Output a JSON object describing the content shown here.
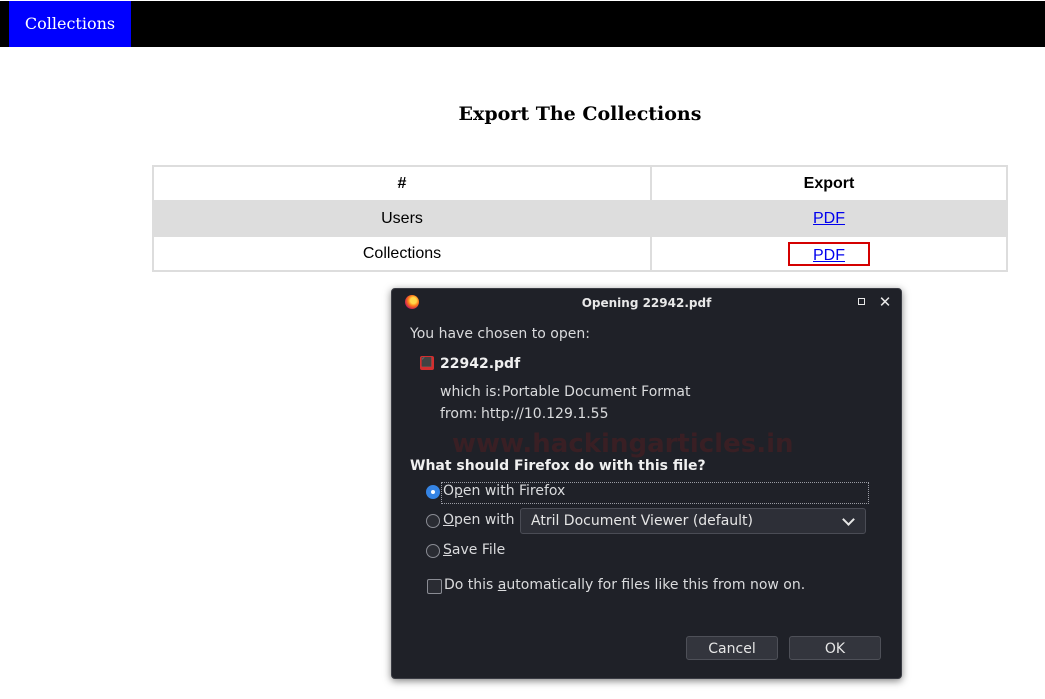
{
  "nav": {
    "active_label": "Collections"
  },
  "page": {
    "title": "Export The Collections"
  },
  "table": {
    "headers": [
      "#",
      "Export"
    ],
    "rows": [
      {
        "name": "Users",
        "link": "PDF"
      },
      {
        "name": "Collections",
        "link": "PDF"
      }
    ]
  },
  "dialog": {
    "title": "Opening 22942.pdf",
    "chosen_text": "You have chosen to open:",
    "filename": "22942.pdf",
    "which_is_label": "which is:",
    "which_is_value": "Portable Document Format",
    "from_label": "from:",
    "from_value": "http://10.129.1.55",
    "question": "What should Firefox do with this file?",
    "options": {
      "open_with_firefox": {
        "prefix": "O",
        "underlined": "p",
        "suffix": "en with Firefox",
        "checked": true
      },
      "open_with": {
        "prefix": "",
        "underlined": "O",
        "suffix": "pen with",
        "checked": false
      },
      "save_file": {
        "prefix": "",
        "underlined": "S",
        "suffix": "ave File",
        "checked": false
      }
    },
    "app_select_value": "Atril Document Viewer (default)",
    "auto_checkbox": {
      "prefix": "Do this ",
      "underlined": "a",
      "suffix": "utomatically for files like this from now on.",
      "checked": false
    },
    "cancel_label": "Cancel",
    "ok_label": "OK",
    "watermark": "www.hackingarticles.in"
  }
}
